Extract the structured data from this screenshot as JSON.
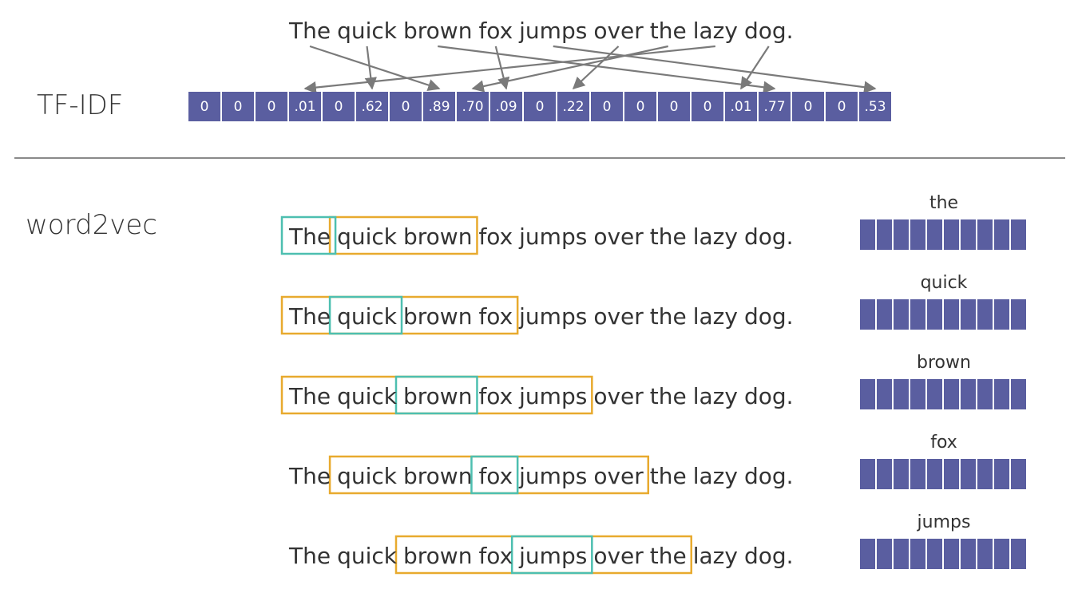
{
  "tfidf": {
    "label": "TF-IDF",
    "sentence_words": [
      "The",
      "quick",
      "brown",
      "fox",
      "jumps",
      "over",
      "the",
      "lazy",
      "dog."
    ],
    "values": [
      "0",
      "0",
      "0",
      ".01",
      "0",
      ".62",
      "0",
      ".89",
      ".70",
      ".09",
      "0",
      ".22",
      "0",
      "0",
      "0",
      "0",
      ".01",
      ".77",
      "0",
      "0",
      ".53"
    ]
  },
  "word2vec": {
    "label": "word2vec",
    "sentence_words": [
      "The",
      "quick",
      "brown",
      "fox",
      "jumps",
      "over",
      "the",
      "lazy",
      "dog."
    ],
    "rows": [
      {
        "word": "the",
        "target": 0,
        "context_start": 1,
        "context_end": 2
      },
      {
        "word": "quick",
        "target": 1,
        "context_start": 0,
        "context_end": 3
      },
      {
        "word": "brown",
        "target": 2,
        "context_start": 0,
        "context_end": 4
      },
      {
        "word": "fox",
        "target": 3,
        "context_start": 1,
        "context_end": 5
      },
      {
        "word": "jumps",
        "target": 4,
        "context_start": 2,
        "context_end": 6
      }
    ],
    "embedding_cells": 10
  },
  "colors": {
    "vector": "#5a5ea0",
    "target_box": "#4dbfb0",
    "context_box": "#e8aa2e",
    "arrow": "#7a7a7a"
  }
}
